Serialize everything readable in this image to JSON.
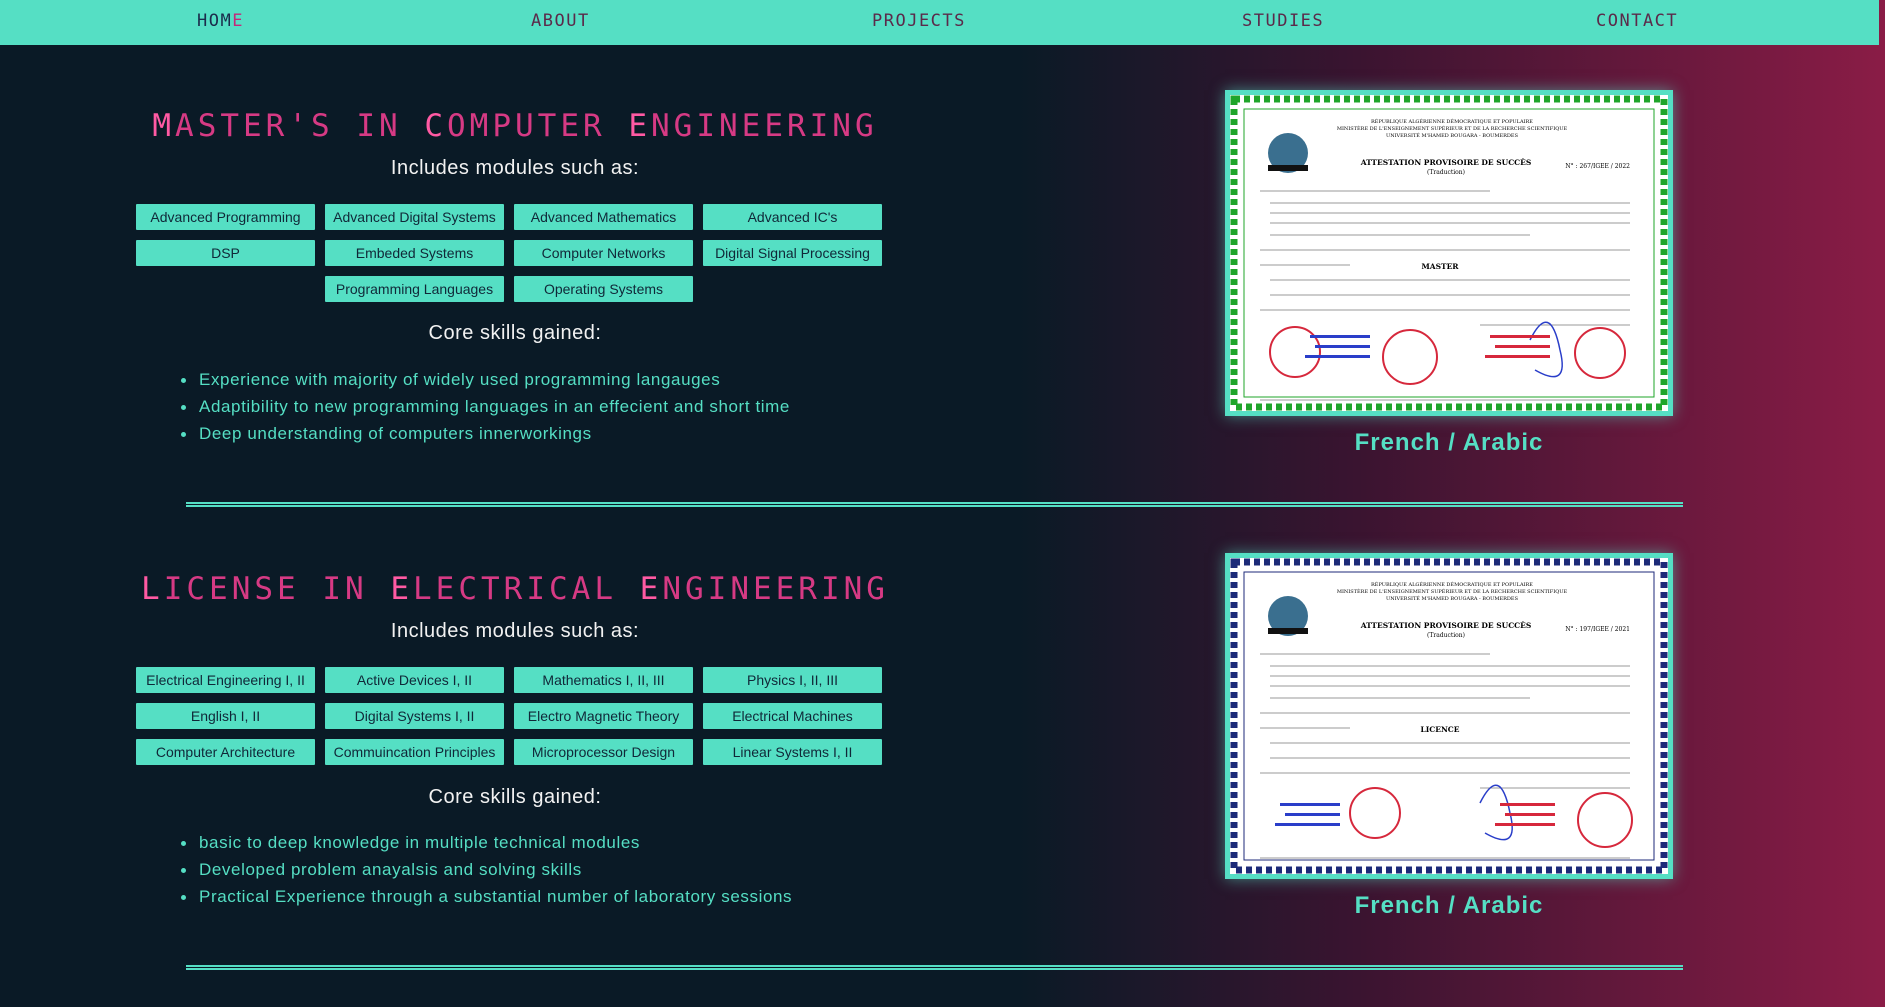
{
  "nav": {
    "items": [
      {
        "label_pre": "HOM",
        "label_hl": "E",
        "name": "home"
      },
      {
        "label_pre": "ABOUT",
        "label_hl": "",
        "name": "about"
      },
      {
        "label_pre": "PROJECTS",
        "label_hl": "",
        "name": "projects"
      },
      {
        "label_pre": "STUDIES",
        "label_hl": "",
        "name": "studies"
      },
      {
        "label_pre": "CONTACT",
        "label_hl": "",
        "name": "contact"
      }
    ]
  },
  "degrees": [
    {
      "title_parts": [
        {
          "cap": "M",
          "rest": "ASTER'S IN "
        },
        {
          "cap": "C",
          "rest": "OMPUTER "
        },
        {
          "cap": "E",
          "rest": "NGINEERING"
        }
      ],
      "modules_heading": "Includes modules such as:",
      "modules": [
        "Advanced Programming",
        "Advanced Digital Systems",
        "Advanced Mathematics",
        "Advanced IC's",
        "DSP",
        "Embeded Systems",
        "Computer Networks",
        "Digital Signal Processing",
        "Programming Languages",
        "Operating Systems"
      ],
      "skills_heading": "Core skills gained:",
      "skills": [
        "Experience with majority of widely used programming langauges",
        "Adaptibility to new programming languages in an effecient and short time",
        "Deep understanding of computers innerworkings"
      ],
      "certificate": {
        "header1": "RÉPUBLIQUE ALGÉRIENNE DÉMOCRATIQUE ET POPULAIRE",
        "header2": "MINISTÈRE DE L'ENSEIGNEMENT SUPÉRIEUR ET DE LA RECHERCHE SCIENTIFIQUE",
        "header3": "UNIVERSITÉ M'HAMED BOUGARA - BOUMERDES",
        "title": "ATTESTATION PROVISOIRE DE SUCCÈS",
        "subtitle": "(Traduction)",
        "number": "N° : 267/IGEE / 2022",
        "degree": "MASTER",
        "border_color": "#1fa52a",
        "caption": "French / Arabic"
      }
    },
    {
      "title_parts": [
        {
          "cap": "L",
          "rest": "ICENSE IN "
        },
        {
          "cap": "E",
          "rest": "LECTRICAL "
        },
        {
          "cap": "E",
          "rest": "NGINEERING"
        }
      ],
      "modules_heading": "Includes modules such as:",
      "modules": [
        "Electrical Engineering I, II",
        "Active Devices I, II",
        "Mathematics I, II, III",
        "Physics I, II, III",
        "English I, II",
        "Digital Systems I, II",
        "Electro Magnetic Theory",
        "Electrical Machines",
        "Computer Architecture",
        "Commuincation Principles",
        "Microprocessor Design",
        "Linear Systems I, II"
      ],
      "skills_heading": "Core skills gained:",
      "skills": [
        "basic to deep knowledge in multiple technical modules",
        "Developed problem anayalsis and solving skills",
        "Practical Experience through a substantial number of laboratory sessions"
      ],
      "certificate": {
        "header1": "RÉPUBLIQUE ALGÉRIENNE DÉMOCRATIQUE ET POPULAIRE",
        "header2": "MINISTÈRE DE L'ENSEIGNEMENT SUPÉRIEUR ET DE LA RECHERCHE SCIENTIFIQUE",
        "header3": "UNIVERSITÉ M'HAMED BOUGARA - BOUMERDES",
        "title": "ATTESTATION PROVISOIRE DE SUCCÈS",
        "subtitle": "(Traduction)",
        "number": "N° : 197/IGEE / 2021",
        "degree": "LICENCE",
        "border_color": "#1c2a78",
        "caption": "French / Arabic"
      }
    }
  ],
  "colors": {
    "accent": "#55dfc4",
    "title": "#d63a84",
    "background": "#0a1a26",
    "gradient_end": "#8a1c46"
  }
}
